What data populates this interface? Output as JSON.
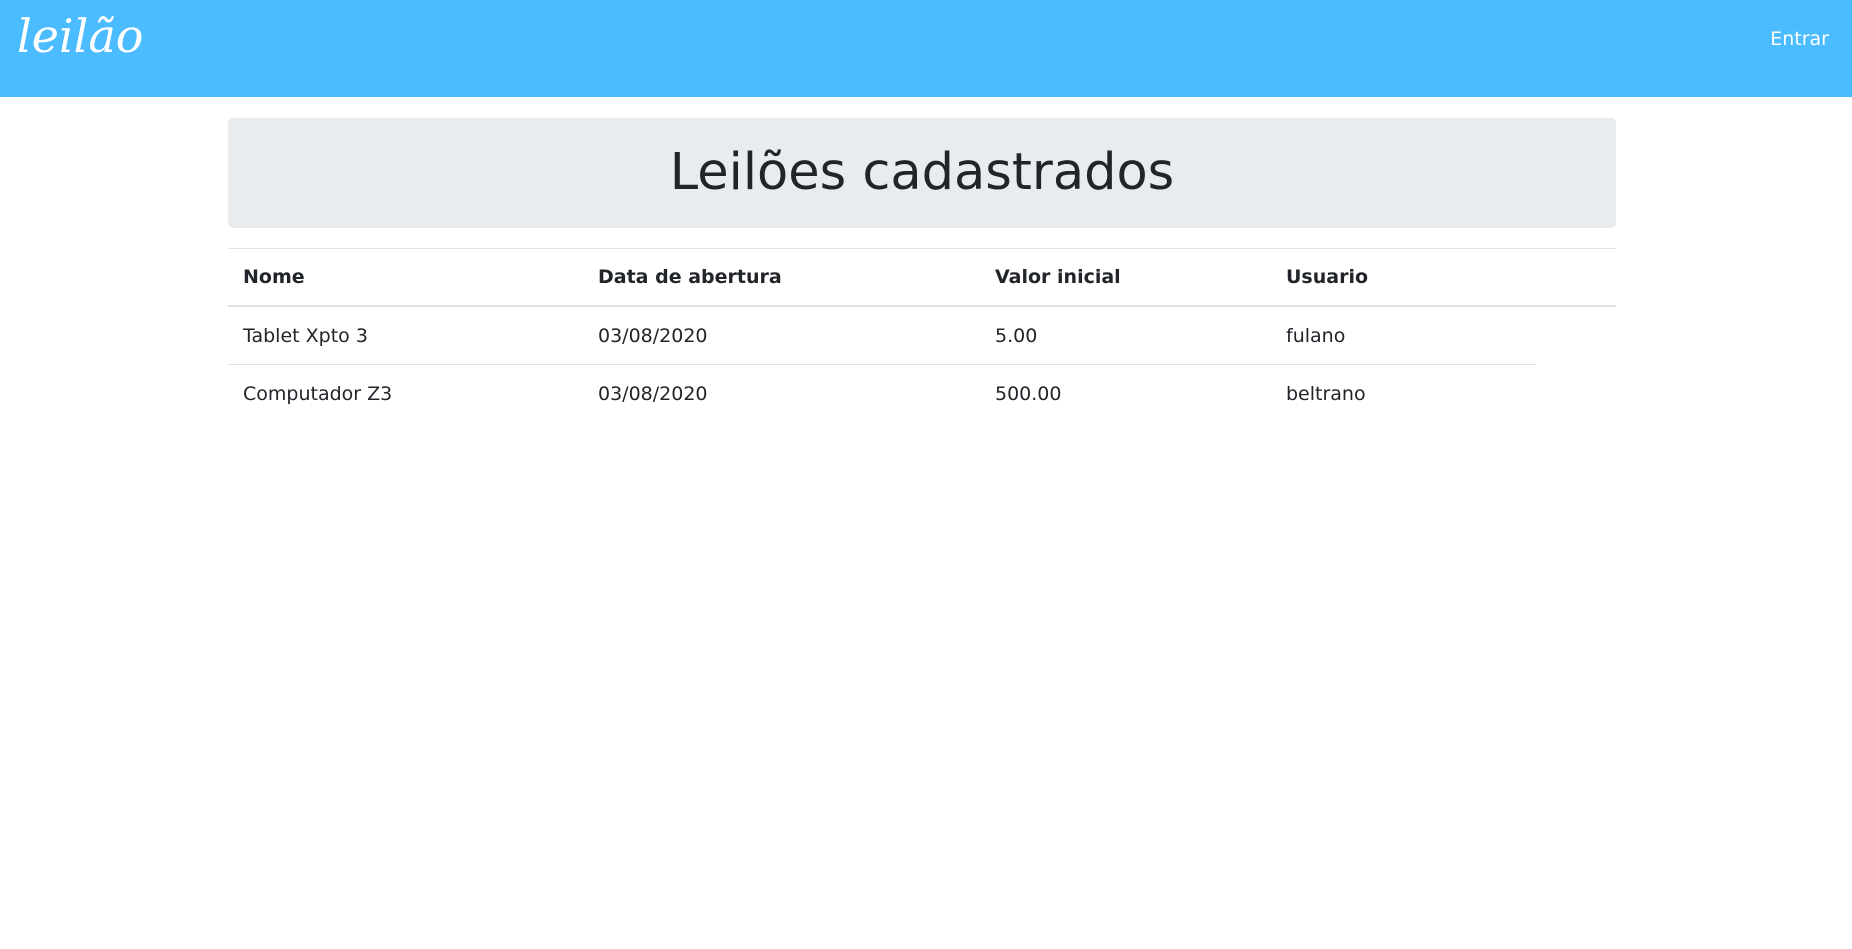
{
  "navbar": {
    "brand": "leilão",
    "login_label": "Entrar"
  },
  "jumbotron": {
    "title": "Leilões cadastrados"
  },
  "table": {
    "columns": [
      "Nome",
      "Data de abertura",
      "Valor inicial",
      "Usuario"
    ],
    "rows": [
      [
        "Tablet Xpto 3",
        "03/08/2020",
        "5.00",
        "fulano"
      ],
      [
        "Computador Z3",
        "03/08/2020",
        "500.00",
        "beltrano"
      ]
    ]
  },
  "colors": {
    "navbar_bg": "#4abcff",
    "jumbotron_bg": "#e9ecef",
    "text": "#212529"
  }
}
